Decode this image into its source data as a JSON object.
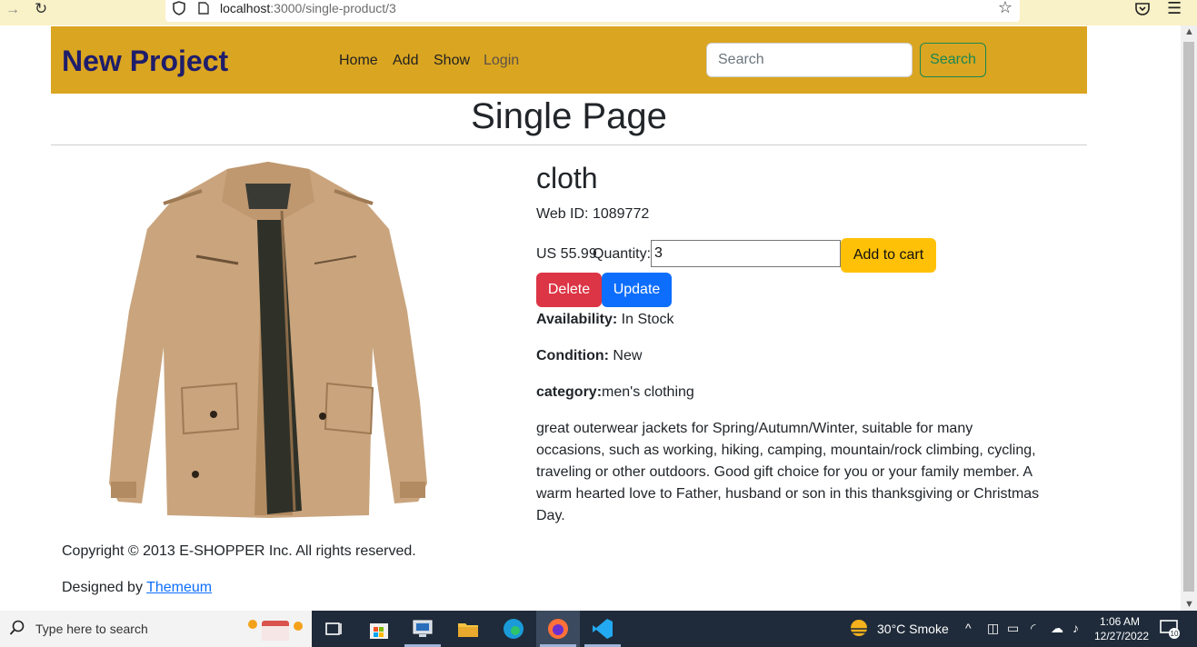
{
  "browser": {
    "url_host": "localhost",
    "url_path": ":3000/single-product/3"
  },
  "navbar": {
    "brand": "New Project",
    "links": [
      "Home",
      "Add",
      "Show",
      "Login"
    ],
    "search_placeholder": "Search",
    "search_button": "Search"
  },
  "page": {
    "title": "Single Page"
  },
  "product": {
    "name": "cloth",
    "web_id": "Web ID: 1089772",
    "price": "US 55.99",
    "quantity_label": "Quantity:",
    "quantity_value": "3",
    "add_to_cart": "Add to cart",
    "delete": "Delete",
    "update": "Update",
    "availability_label": "Availability:",
    "availability_value": " In Stock",
    "condition_label": "Condition:",
    "condition_value": " New",
    "category_label": "category:",
    "category_value": "men's clothing",
    "description": "great outerwear jackets for Spring/Autumn/Winter, suitable for many occasions, such as working, hiking, camping, mountain/rock climbing, cycling, traveling or other outdoors. Good gift choice for you or your family member. A warm hearted love to Father, husband or son in this thanksgiving or Christmas Day."
  },
  "footer": {
    "copyright": "Copyright © 2013 E-SHOPPER Inc. All rights reserved.",
    "designed_by": "Designed by ",
    "designer_link": "Themeum"
  },
  "taskbar": {
    "search_text": "Type here to search",
    "temperature": "30°C  Smoke",
    "time": "1:06 AM",
    "date": "12/27/2022",
    "notification_count": "10"
  }
}
